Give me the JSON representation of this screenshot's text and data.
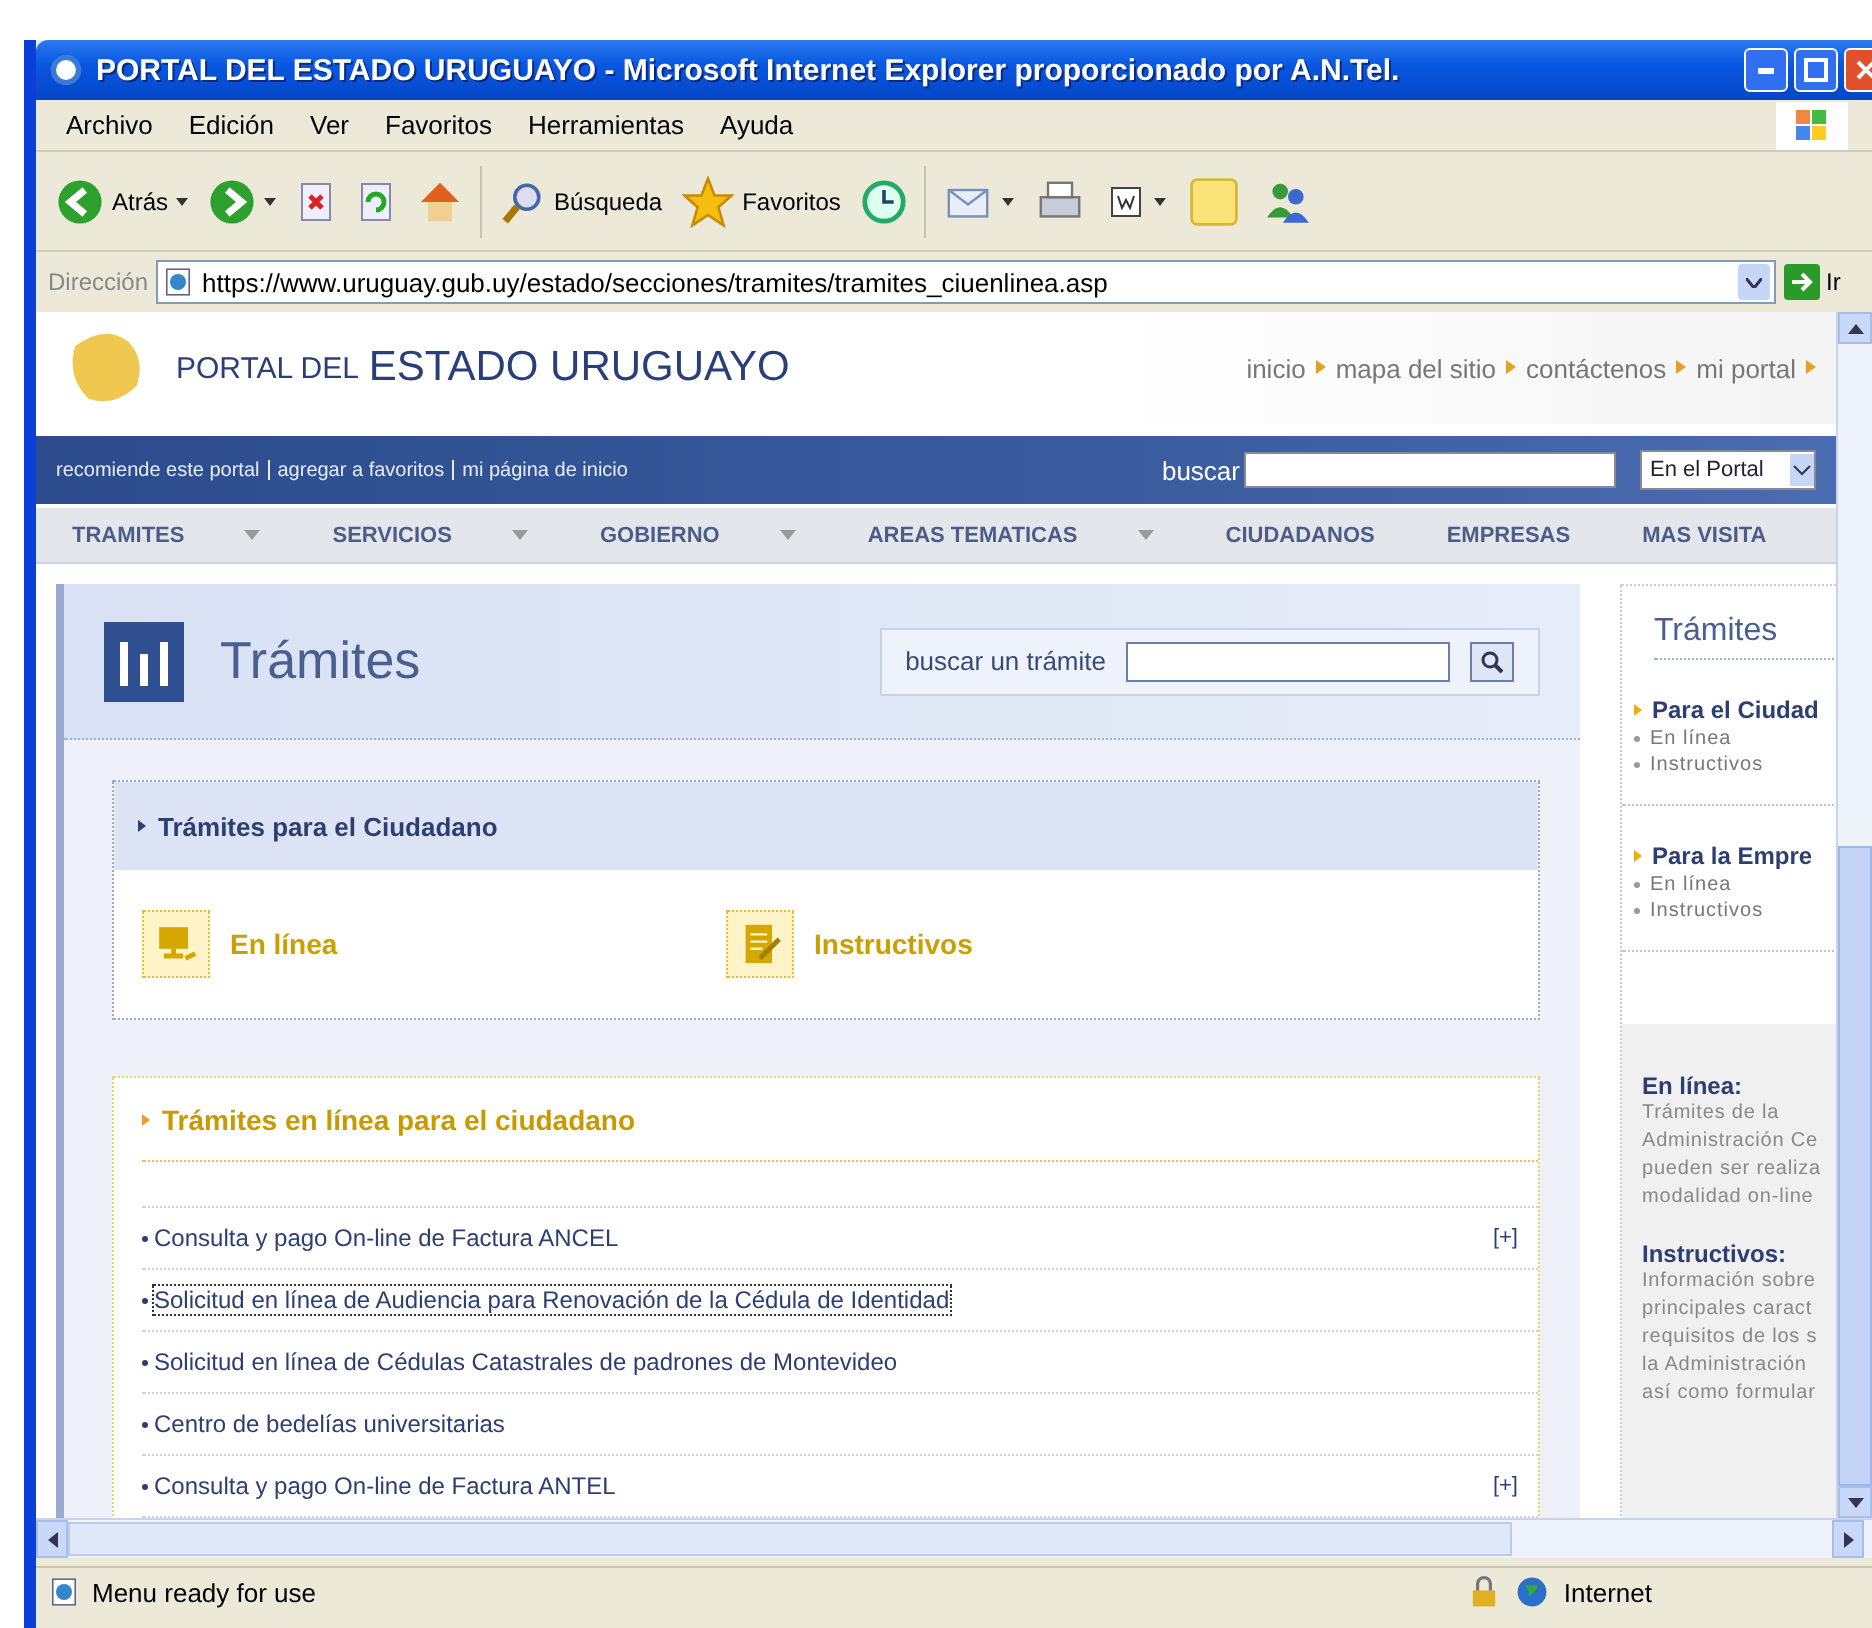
{
  "window": {
    "title": "PORTAL DEL ESTADO URUGUAYO - Microsoft Internet Explorer proporcionado por A.N.Tel."
  },
  "menu": [
    "Archivo",
    "Edición",
    "Ver",
    "Favoritos",
    "Herramientas",
    "Ayuda"
  ],
  "toolbar": [
    {
      "kind": "back",
      "label": "Atrás",
      "dropdown": true
    },
    {
      "kind": "forward",
      "dropdown": true
    },
    {
      "kind": "stop",
      "dropdown": false
    },
    {
      "kind": "refresh",
      "dropdown": false
    },
    {
      "kind": "home",
      "dropdown": false
    },
    {
      "kind": "search",
      "label": "Búsqueda",
      "dropdown": false
    },
    {
      "kind": "favorites",
      "label": "Favoritos",
      "dropdown": false
    },
    {
      "kind": "history",
      "dropdown": false
    },
    {
      "kind": "mail",
      "dropdown": true
    },
    {
      "kind": "print",
      "dropdown": false
    },
    {
      "kind": "word",
      "dropdown": true
    },
    {
      "kind": "notes",
      "dropdown": false
    },
    {
      "kind": "messenger",
      "dropdown": false
    }
  ],
  "address": {
    "label": "Dirección",
    "url": "https://www.uruguay.gub.uy/estado/secciones/tramites/tramites_ciuenlinea.asp",
    "go": "Ir"
  },
  "site": {
    "logo_small": "PORTAL DEL",
    "logo_large": "ESTADO URUGUAYO",
    "top_links": [
      "inicio",
      "mapa del sitio",
      "contáctenos",
      "mi portal"
    ],
    "utility_links": [
      "recomiende este portal",
      "agregar a favoritos",
      "mi página de inicio"
    ],
    "search_label": "buscar",
    "scope": "En el Portal",
    "nav": [
      {
        "label": "TRAMITES",
        "dropdown": true
      },
      {
        "label": "SERVICIOS",
        "dropdown": true
      },
      {
        "label": "GOBIERNO",
        "dropdown": true
      },
      {
        "label": "AREAS TEMATICAS",
        "dropdown": true
      },
      {
        "label": "CIUDADANOS",
        "dropdown": false
      },
      {
        "label": "EMPRESAS",
        "dropdown": false
      },
      {
        "label": "MAS VISITA",
        "dropdown": false
      }
    ]
  },
  "main": {
    "title": "Trámites",
    "search_label": "buscar un trámite",
    "section": {
      "title": "Trámites para el Ciudadano",
      "options": [
        {
          "kind": "online",
          "label": "En línea"
        },
        {
          "kind": "guides",
          "label": "Instructivos"
        }
      ]
    },
    "list": {
      "title": "Trámites en línea para el ciudadano",
      "items": [
        {
          "text": "Consulta y pago On-line de Factura ANCEL",
          "more": "[+]",
          "focused": false
        },
        {
          "text": "Solicitud en línea de Audiencia para Renovación de la Cédula de Identidad",
          "focused": true
        },
        {
          "text": "Solicitud en línea de Cédulas Catastrales de padrones de Montevideo",
          "focused": false
        },
        {
          "text": "Centro de bedelías universitarias",
          "focused": false
        },
        {
          "text": "Consulta y pago On-line de Factura ANTEL",
          "more": "[+]",
          "focused": false
        }
      ]
    }
  },
  "sidebar": {
    "title": "Trámites",
    "groups": [
      {
        "title": "Para el Ciudad",
        "items": [
          "En línea",
          "Instructivos"
        ]
      },
      {
        "title": "Para la Empre",
        "items": [
          "En línea",
          "Instructivos"
        ]
      }
    ],
    "info": [
      {
        "title": "En línea:",
        "lines": [
          "Trámites de la",
          "Administración Ce",
          "pueden ser realiza",
          "modalidad on-line"
        ]
      },
      {
        "title": "Instructivos:",
        "lines": [
          "Información sobre",
          "principales caract",
          "requisitos de los s",
          "la Administración",
          "así como formular"
        ]
      }
    ]
  },
  "status_bar": {
    "text": "Menu ready for use",
    "zone": "Internet"
  }
}
